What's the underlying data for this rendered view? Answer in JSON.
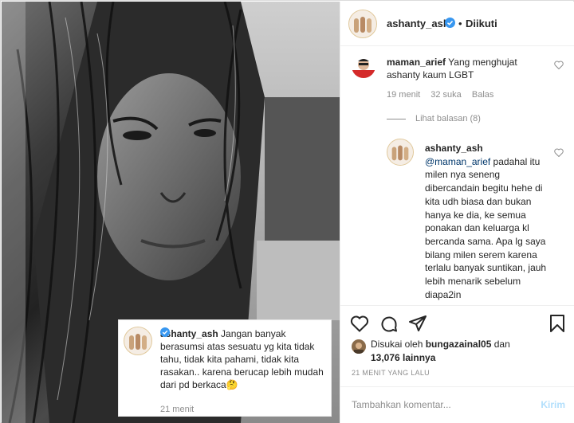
{
  "post": {
    "author": "ashanty_ash",
    "follow_status": "Diikuti",
    "separator": "•"
  },
  "overlay_comment": {
    "author": "ashanty_ash",
    "text": "Jangan banyak berasumsi atas sesuatu yg kita tidak tahu, tidak kita pahami, tidak kita rasakan.. karena berucap lebih mudah dari pd berkaca🤔",
    "time": "21 menit"
  },
  "comment": {
    "author": "maman_arief",
    "text": "Yang menghujat ashanty kaum LGBT",
    "time": "19 menit",
    "likes": "32 suka",
    "reply_label": "Balas"
  },
  "view_replies_label": "Lihat balasan (8)",
  "reply": {
    "author": "ashanty_ash",
    "mention": "@maman_arief",
    "text": " padahal itu milen nya seneng dibercandain begitu hehe di kita udh biasa dan bukan hanya ke dia, ke semua ponakan dan keluarga kl bercanda sama. Apa lg saya bilang milen serem karena terlalu banyak suntikan, jauh lebih menarik sebelum diapa2in"
  },
  "likes": {
    "prefix": "Disukai oleh ",
    "user": "bungazainal05",
    "middle": " dan ",
    "count": "13,076 lainnya"
  },
  "timestamp": "21 MENIT YANG LALU",
  "add_comment": {
    "placeholder": "Tambahkan komentar...",
    "send_label": "Kirim"
  },
  "icons": {
    "verified": "verified-badge-icon",
    "heart": "heart-icon",
    "comment": "comment-icon",
    "share": "share-icon",
    "save": "bookmark-icon"
  },
  "colors": {
    "verified": "#3897f0",
    "link": "#00376b",
    "muted": "#8e8e8e",
    "send_disabled": "#b2dffc"
  }
}
